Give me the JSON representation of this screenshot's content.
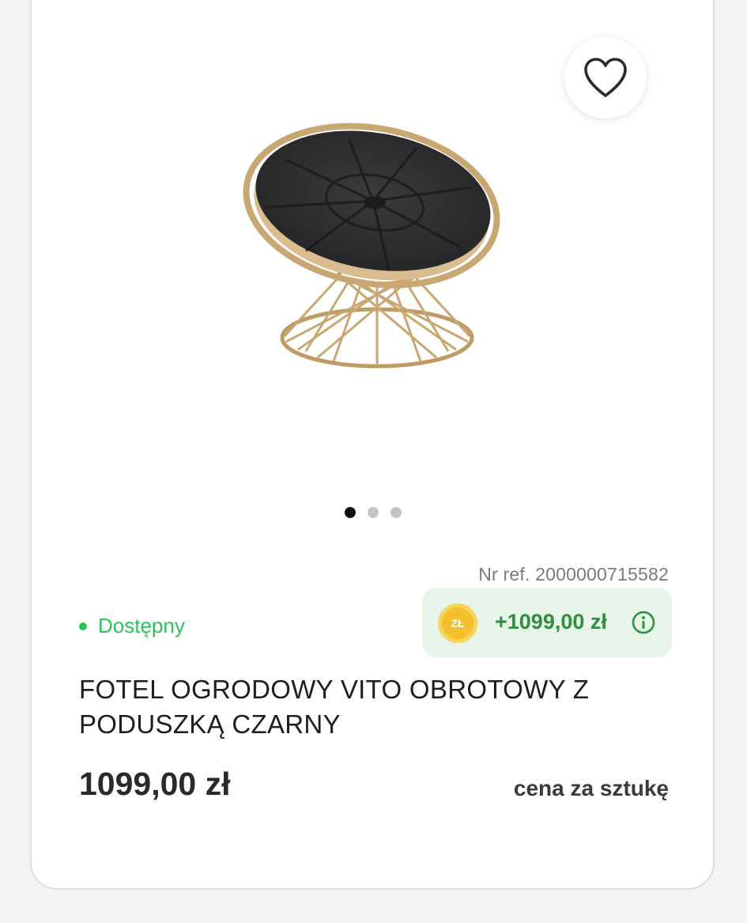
{
  "product": {
    "availability": "Dostępny",
    "ref_label": "Nr ref. 2000000715582",
    "points": {
      "coin_label": "ZŁ",
      "value": "+1099,00 zł"
    },
    "title": "FOTEL OGRODOWY VITO OBROTOWY Z PODUSZKĄ CZARNY",
    "price": "1099,00 zł",
    "unit_label": "cena za sztukę"
  },
  "carousel": {
    "total": 3,
    "active": 1
  },
  "icons": {
    "favorite": "heart-icon",
    "info": "info-icon",
    "coin": "coin-icon"
  },
  "colors": {
    "available": "#29c25b",
    "points_bg": "#e6f4ea",
    "points_text": "#2f8f3e",
    "coin": "#f3c02c"
  }
}
